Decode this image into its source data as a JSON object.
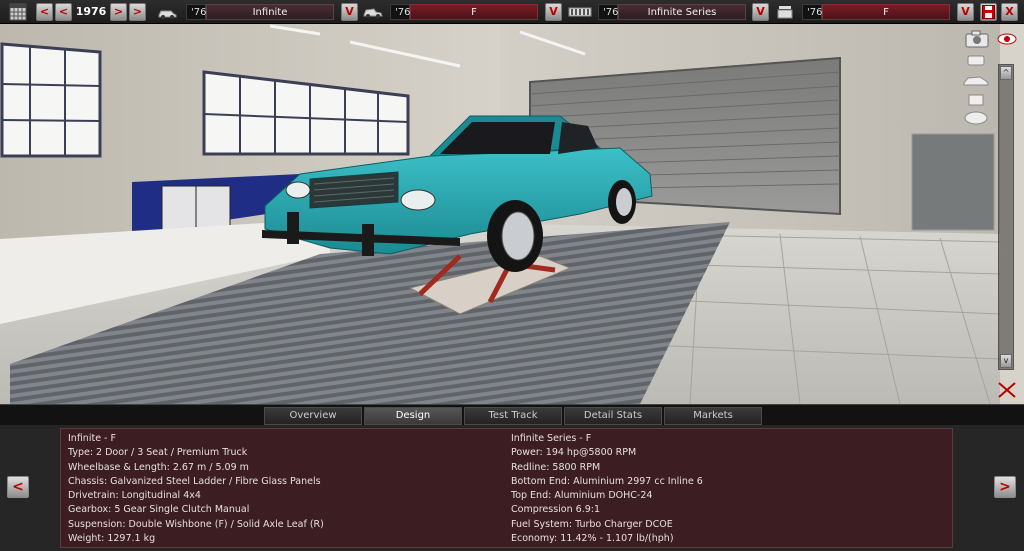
{
  "toolbar": {
    "calendar_icon": "calendar-icon",
    "prev_fast": "<",
    "prev": "<",
    "year": "1976",
    "next": ">",
    "next_fast": ">",
    "model_year": "'76",
    "model_name": "Infinite",
    "dropdown1": "V",
    "trim_year": "'76",
    "trim_name": "F",
    "dropdown2": "V",
    "engine_year": "'76",
    "engine_name": "Infinite Series",
    "dropdown3": "V",
    "variant_year": "'76",
    "variant_name": "F",
    "dropdown4": "V",
    "close": "X"
  },
  "vtoolbar": {
    "up": "^",
    "down": "v"
  },
  "tabs": [
    "Overview",
    "Design",
    "Test Track",
    "Detail Stats",
    "Markets"
  ],
  "active_tab": "Design",
  "info": {
    "left": [
      "Infinite - F",
      "Type: 2 Door / 3 Seat / Premium Truck",
      "Wheelbase & Length: 2.67 m / 5.09 m",
      "Chassis: Galvanized Steel Ladder / Fibre Glass Panels",
      "Drivetrain: Longitudinal 4x4",
      "Gearbox: 5 Gear Single Clutch Manual",
      "Suspension: Double Wishbone (F) / Solid Axle Leaf (R)",
      "Weight: 1297.1 kg"
    ],
    "right": [
      "Infinite Series - F",
      "Power: 194 hp@5800 RPM",
      "Redline: 5800 RPM",
      "Bottom End: Aluminium 2997 cc Inline 6",
      "Top End: Aluminium DOHC-24",
      "Compression 6.9:1",
      "Fuel System: Turbo Charger DCOE",
      "Economy: 11.42% - 1.107 lb/(hph)"
    ],
    "prev_button": "<",
    "next_button": ">"
  },
  "colors": {
    "car_body": "#2aa8b0",
    "panel_bg": "#3c1e22",
    "accent_red": "#b00000"
  }
}
